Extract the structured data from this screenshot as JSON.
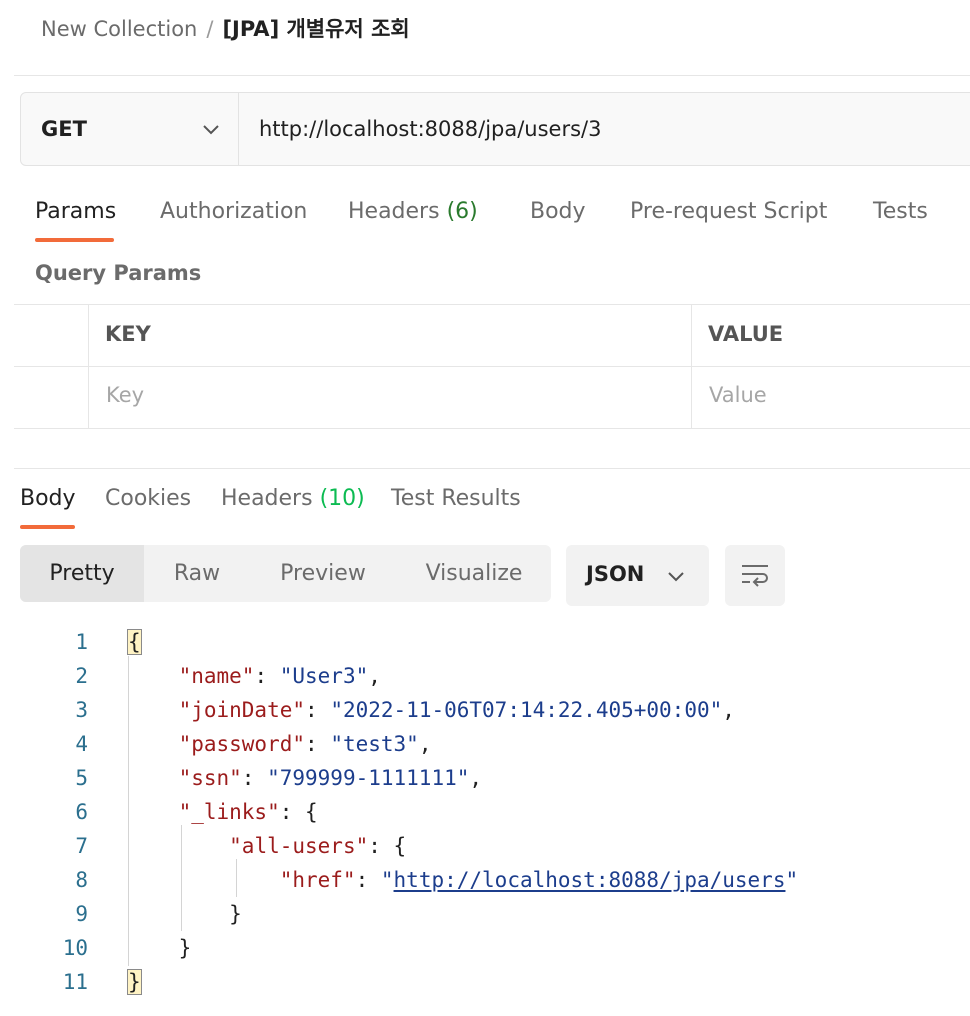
{
  "breadcrumb": {
    "parent": "New Collection",
    "separator": "/",
    "current": "[JPA] 개별유저 조회"
  },
  "request": {
    "method": "GET",
    "url": "http://localhost:8088/jpa/users/3"
  },
  "request_tabs": [
    {
      "label": "Params"
    },
    {
      "label": "Authorization"
    },
    {
      "label": "Headers",
      "count": "(6)"
    },
    {
      "label": "Body"
    },
    {
      "label": "Pre-request Script"
    },
    {
      "label": "Tests"
    }
  ],
  "query_params": {
    "title": "Query Params",
    "headers": {
      "key": "KEY",
      "value": "VALUE"
    },
    "placeholders": {
      "key": "Key",
      "value": "Value"
    }
  },
  "response_tabs": [
    {
      "label": "Body"
    },
    {
      "label": "Cookies"
    },
    {
      "label": "Headers",
      "count": "(10)"
    },
    {
      "label": "Test Results"
    }
  ],
  "view_modes": [
    "Pretty",
    "Raw",
    "Preview",
    "Visualize"
  ],
  "format": "JSON",
  "icons": {
    "chevron": "chevron-down-icon",
    "wrap": "text-wrap-icon"
  },
  "colors": {
    "accent": "#f26b3a",
    "count_green": "#0cbb52",
    "json_key": "#9b1c1c",
    "json_string": "#1c3d8c"
  },
  "code_lines": [
    {
      "no": "1",
      "tokens": [
        {
          "t": "{",
          "c": "hl"
        }
      ]
    },
    {
      "no": "2",
      "tokens": [
        {
          "t": "    ",
          "c": "p"
        },
        {
          "t": "\"name\"",
          "c": "k"
        },
        {
          "t": ": ",
          "c": "p"
        },
        {
          "t": "\"User3\"",
          "c": "s"
        },
        {
          "t": ",",
          "c": "p"
        }
      ]
    },
    {
      "no": "3",
      "tokens": [
        {
          "t": "    ",
          "c": "p"
        },
        {
          "t": "\"joinDate\"",
          "c": "k"
        },
        {
          "t": ": ",
          "c": "p"
        },
        {
          "t": "\"2022-11-06T07:14:22.405+00:00\"",
          "c": "s"
        },
        {
          "t": ",",
          "c": "p"
        }
      ]
    },
    {
      "no": "4",
      "tokens": [
        {
          "t": "    ",
          "c": "p"
        },
        {
          "t": "\"password\"",
          "c": "k"
        },
        {
          "t": ": ",
          "c": "p"
        },
        {
          "t": "\"test3\"",
          "c": "s"
        },
        {
          "t": ",",
          "c": "p"
        }
      ]
    },
    {
      "no": "5",
      "tokens": [
        {
          "t": "    ",
          "c": "p"
        },
        {
          "t": "\"ssn\"",
          "c": "k"
        },
        {
          "t": ": ",
          "c": "p"
        },
        {
          "t": "\"799999-1111111\"",
          "c": "s"
        },
        {
          "t": ",",
          "c": "p"
        }
      ]
    },
    {
      "no": "6",
      "tokens": [
        {
          "t": "    ",
          "c": "p"
        },
        {
          "t": "\"_links\"",
          "c": "k"
        },
        {
          "t": ": {",
          "c": "p"
        }
      ]
    },
    {
      "no": "7",
      "tokens": [
        {
          "t": "        ",
          "c": "p"
        },
        {
          "t": "\"all-users\"",
          "c": "k"
        },
        {
          "t": ": {",
          "c": "p"
        }
      ]
    },
    {
      "no": "8",
      "tokens": [
        {
          "t": "            ",
          "c": "p"
        },
        {
          "t": "\"href\"",
          "c": "k"
        },
        {
          "t": ": ",
          "c": "p"
        },
        {
          "t": "\"",
          "c": "s"
        },
        {
          "t": "http://localhost:8088/jpa/users",
          "c": "u"
        },
        {
          "t": "\"",
          "c": "s"
        }
      ]
    },
    {
      "no": "9",
      "tokens": [
        {
          "t": "        ",
          "c": "p"
        },
        {
          "t": "}",
          "c": "p"
        }
      ]
    },
    {
      "no": "10",
      "tokens": [
        {
          "t": "    ",
          "c": "p"
        },
        {
          "t": "}",
          "c": "p"
        }
      ]
    },
    {
      "no": "11",
      "tokens": [
        {
          "t": "}",
          "c": "hl"
        }
      ]
    }
  ]
}
